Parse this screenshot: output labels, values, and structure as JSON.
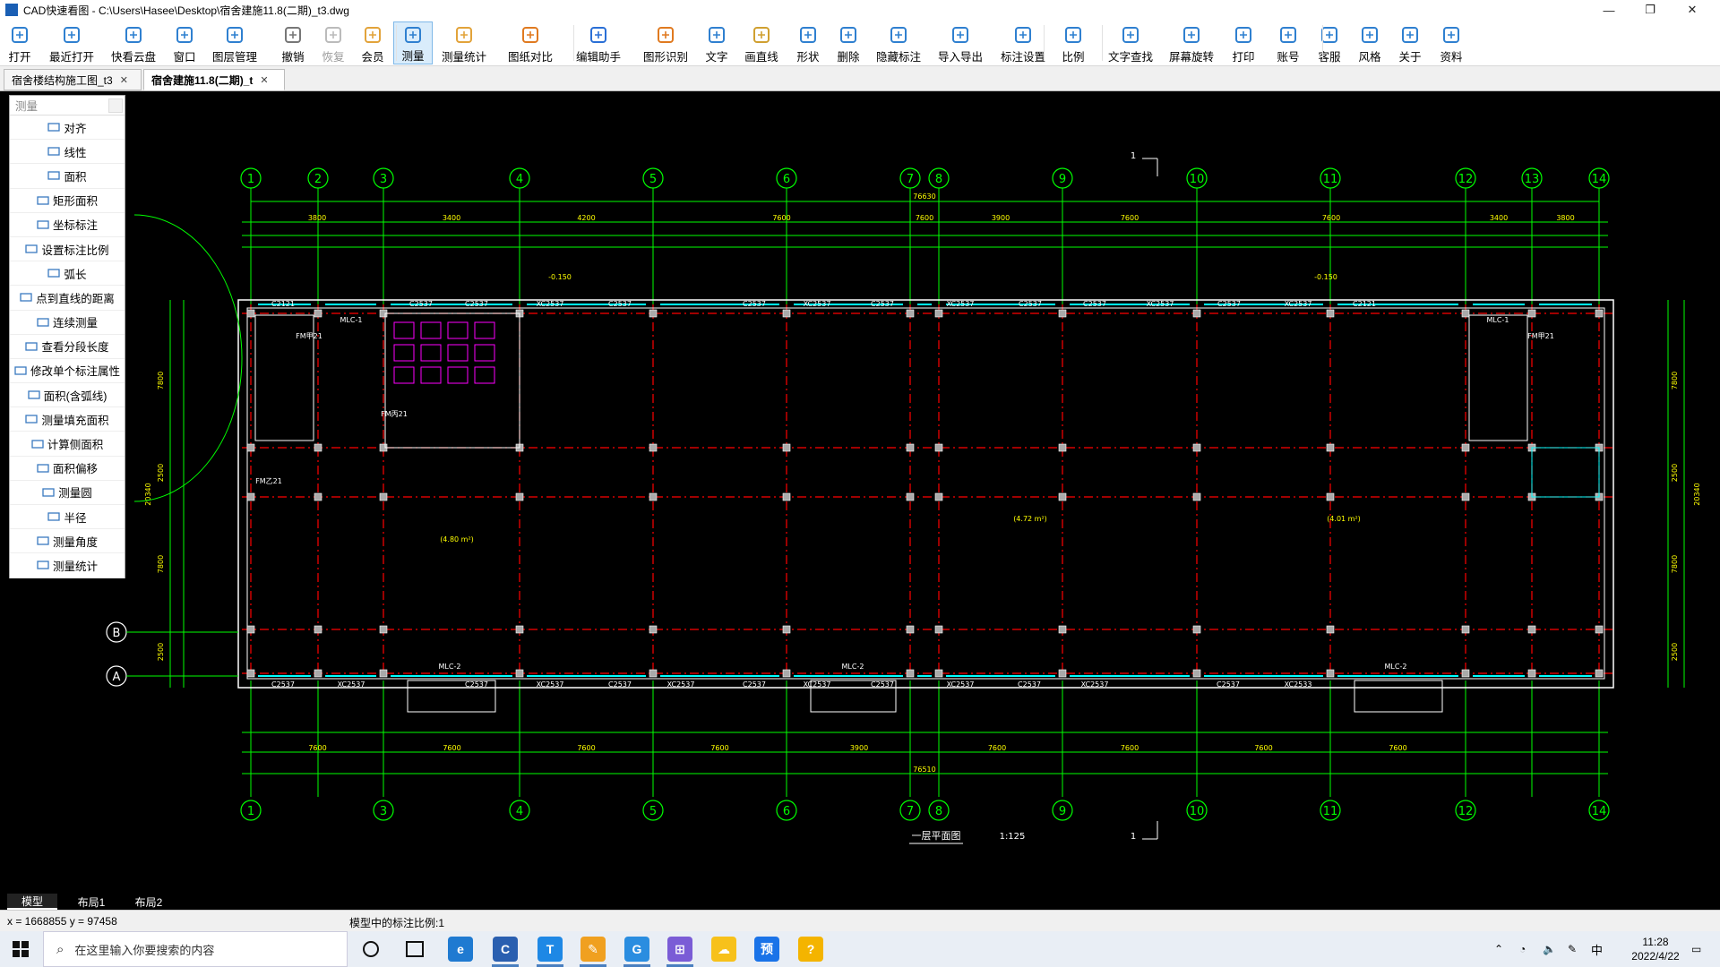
{
  "window": {
    "title": "CAD快速看图 - C:\\Users\\Hasee\\Desktop\\宿舍建施11.8(二期)_t3.dwg",
    "controls": [
      "—",
      "❐",
      "✕"
    ]
  },
  "toolbar": {
    "items": [
      {
        "label": "打开",
        "icon": "folder-open-icon"
      },
      {
        "label": "最近打开",
        "icon": "history-icon"
      },
      {
        "label": "快看云盘",
        "icon": "cloud-icon"
      },
      {
        "label": "窗口",
        "icon": "window-icon"
      },
      {
        "label": "图层管理",
        "icon": "layers-icon"
      },
      {
        "label": "撤销",
        "icon": "undo-icon"
      },
      {
        "label": "恢复",
        "icon": "redo-icon"
      },
      {
        "label": "会员",
        "icon": "vip-icon"
      },
      {
        "label": "测量",
        "icon": "measure-icon"
      },
      {
        "label": "测量统计",
        "icon": "measure-stats-icon"
      },
      {
        "label": "图纸对比",
        "icon": "compare-icon"
      },
      {
        "label": "编辑助手",
        "icon": "edit-assistant-icon"
      },
      {
        "label": "图形识别",
        "icon": "shape-recognize-icon"
      },
      {
        "label": "文字",
        "icon": "text-icon"
      },
      {
        "label": "画直线",
        "icon": "line-icon"
      },
      {
        "label": "形状",
        "icon": "shape-icon"
      },
      {
        "label": "删除",
        "icon": "eraser-icon"
      },
      {
        "label": "隐藏标注",
        "icon": "hide-annotation-icon"
      },
      {
        "label": "导入导出",
        "icon": "import-export-icon"
      },
      {
        "label": "标注设置",
        "icon": "annotation-settings-icon"
      },
      {
        "label": "比例",
        "icon": "scale-icon"
      },
      {
        "label": "文字查找",
        "icon": "text-search-icon"
      },
      {
        "label": "屏幕旋转",
        "icon": "rotate-screen-icon"
      },
      {
        "label": "打印",
        "icon": "print-icon"
      },
      {
        "label": "账号",
        "icon": "account-icon"
      },
      {
        "label": "客服",
        "icon": "headset-icon"
      },
      {
        "label": "风格",
        "icon": "style-icon"
      },
      {
        "label": "关于",
        "icon": "info-icon"
      },
      {
        "label": "资料",
        "icon": "documents-icon"
      }
    ]
  },
  "tabs": [
    {
      "label": "宿舍楼结构施工图_t3",
      "close": "✕"
    },
    {
      "label": "宿舍建施11.8(二期)_t",
      "close": "✕"
    }
  ],
  "measure_panel": {
    "title": "测量",
    "items": [
      "对齐",
      "线性",
      "面积",
      "矩形面积",
      "坐标标注",
      "设置标注比例",
      "弧长",
      "点到直线的距离",
      "连续测量",
      "查看分段长度",
      "修改单个标注属性",
      "面积(含弧线)",
      "测量填充面积",
      "计算侧面积",
      "面积偏移",
      "测量圆",
      "半径",
      "测量角度",
      "测量统计"
    ]
  },
  "drawing": {
    "axis_top": [
      "1",
      "2",
      "3",
      "4",
      "5",
      "6",
      "7",
      "8",
      "9",
      "10",
      "11",
      "12",
      "13",
      "14"
    ],
    "axis_bottom": [
      "1",
      "3",
      "4",
      "5",
      "6",
      "7",
      "8",
      "9",
      "10",
      "11",
      "12",
      "14"
    ],
    "axis_left": [
      "B",
      "A"
    ],
    "dims_top": [
      "3800",
      "3400",
      "4200",
      "7600",
      "7600",
      "3900",
      "7600",
      "7600",
      "3400",
      "3800"
    ],
    "total_width": "76630",
    "total_width_bottom": "76510",
    "dims_bottom": [
      "7600",
      "7600",
      "7600",
      "7600",
      "3900",
      "7600",
      "7600",
      "7600",
      "7600"
    ],
    "dims_right": [
      "7800",
      "2500",
      "7800",
      "2500"
    ],
    "total_depth": "20340",
    "window_labels": [
      "C2121",
      "C2537",
      "C2537",
      "XC2537",
      "C2537",
      "C2537",
      "XC2537",
      "C2537",
      "XC2537",
      "C2537",
      "C2537",
      "XC2537",
      "C2537",
      "XC2537",
      "C2121"
    ],
    "window_labels_bottom": [
      "C2537",
      "XC2537",
      "C2537",
      "XC2537",
      "C2537",
      "XC2537",
      "C2537",
      "XC2537",
      "C2537",
      "XC2537",
      "C2537",
      "XC2537",
      "C2537",
      "XC2533"
    ],
    "door_labels": [
      "MLC-1",
      "MLC-1",
      "MLC-2",
      "MLC-2",
      "MLC-2",
      "FM甲21",
      "FM甲21",
      "FM乙21",
      "FM丙21"
    ],
    "area_notes": [
      "(4.80 m²)",
      "(4.72 m²)",
      "(4.01 m²)"
    ],
    "title": "一层平面图",
    "scale": "1:125",
    "section_mark": "1",
    "elev": "-0.150"
  },
  "layout_tabs": [
    "模型",
    "布局1",
    "布局2"
  ],
  "status": {
    "coords": "x = 1668855  y = 97458",
    "message": "模型中的标注比例:1"
  },
  "taskbar": {
    "search_placeholder": "在这里输入你要搜索的内容",
    "time": "11:28",
    "date": "2022/4/22",
    "ime": "中",
    "apps": [
      "edge-icon",
      "cad-icon",
      "text-app-icon",
      "notes-icon",
      "chrome-icon",
      "store-icon",
      "cloud-app-icon",
      "preview-icon",
      "tips-icon"
    ]
  },
  "colors": {
    "canvas": "#000000",
    "dim_green": "#00ff00",
    "axis_red": "#ff0000",
    "wall_white": "#ffffff",
    "magenta": "#ff00ff",
    "cyan": "#00ffff",
    "yellow": "#ffff00"
  }
}
